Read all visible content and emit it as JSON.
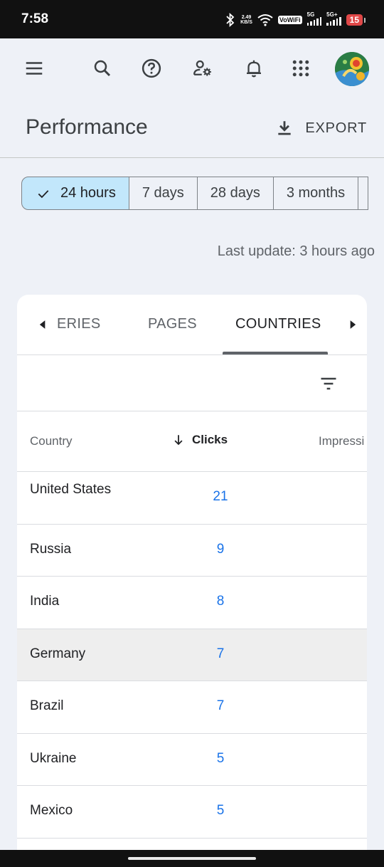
{
  "status_bar": {
    "time": "7:58",
    "net_speed_value": "2.49",
    "net_speed_unit": "KB/S",
    "vowifi": "VoWiFi",
    "sim1_label": "5G",
    "sim2_label": "5G+",
    "battery": "15"
  },
  "header": {
    "title": "Performance",
    "export_label": "EXPORT"
  },
  "date_ranges": [
    {
      "label": "24 hours",
      "selected": true
    },
    {
      "label": "7 days",
      "selected": false
    },
    {
      "label": "28 days",
      "selected": false
    },
    {
      "label": "3 months",
      "selected": false
    }
  ],
  "last_update": "Last update: 3 hours ago",
  "tabs": [
    {
      "label": "ERIES",
      "active": false
    },
    {
      "label": "PAGES",
      "active": false
    },
    {
      "label": "COUNTRIES",
      "active": true
    }
  ],
  "table": {
    "columns": [
      "Country",
      "Clicks",
      "Impressi"
    ],
    "sorted_column": "Clicks",
    "rows": [
      {
        "country": "United States",
        "clicks": "21"
      },
      {
        "country": "Russia",
        "clicks": "9"
      },
      {
        "country": "India",
        "clicks": "8"
      },
      {
        "country": "Germany",
        "clicks": "7"
      },
      {
        "country": "Brazil",
        "clicks": "7"
      },
      {
        "country": "Ukraine",
        "clicks": "5"
      },
      {
        "country": "Mexico",
        "clicks": "5"
      }
    ]
  },
  "icons": {
    "menu": "menu-icon",
    "search": "search-icon",
    "help": "help-icon",
    "admin": "manage-accounts-icon",
    "notifications": "bell-icon",
    "apps": "apps-grid-icon",
    "export": "download-icon",
    "filter": "filter-icon"
  },
  "colors": {
    "accent_blue": "#1a73e8",
    "selected_chip": "#c2e7fb",
    "background": "#eef1f7"
  }
}
